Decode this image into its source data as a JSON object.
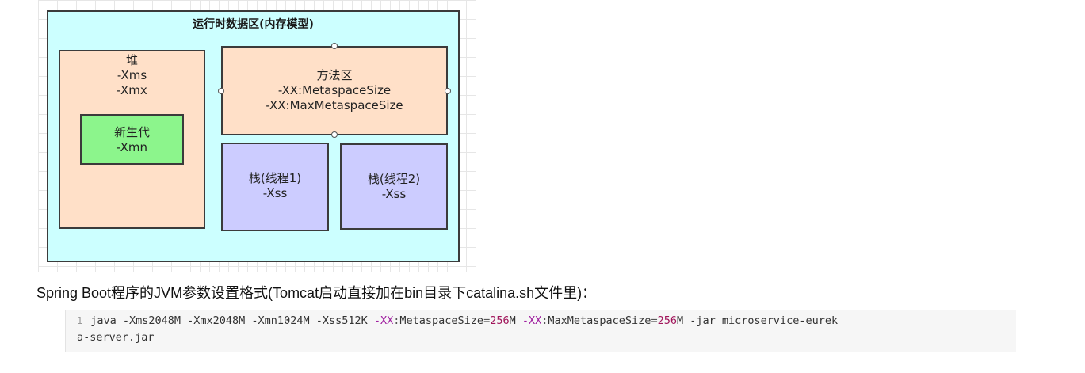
{
  "diagram": {
    "outer_title": "运行时数据区(内存模型)",
    "heap": {
      "name": "堆",
      "params": [
        "-Xms",
        "-Xmx"
      ]
    },
    "young_gen": {
      "name": "新生代",
      "params": [
        "-Xmn"
      ]
    },
    "method_area": {
      "name": "方法区",
      "params": [
        "-XX:MetaspaceSize",
        "-XX:MaxMetaspaceSize"
      ]
    },
    "stack1": {
      "name": "栈(线程1)",
      "params": [
        "-Xss"
      ]
    },
    "stack2": {
      "name": "栈(线程2)",
      "params": [
        "-Xss"
      ]
    },
    "colors": {
      "outer_fill": "#ccffff",
      "heap_fill": "#ffe0c8",
      "young_fill": "#8cf58c",
      "stack_fill": "#ccccff",
      "border": "#3b3b3b"
    }
  },
  "caption": "Spring Boot程序的JVM参数设置格式(Tomcat启动直接加在bin目录下catalina.sh文件里)：",
  "code": {
    "line_number": "1",
    "t1": "java -Xms2048M -Xmx2048M -Xmn1024M -Xss512K ",
    "kw1": "-XX",
    "op1": ":",
    "t2": "MetaspaceSize",
    "eq1": "=",
    "num1": "256",
    "t3": "M ",
    "kw2": "-XX",
    "op2": ":",
    "t4": "MaxMetaspaceSize",
    "eq2": "=",
    "num2": "256",
    "t5": "M -jar microservice-eurek",
    "line2": "a-server.jar"
  }
}
